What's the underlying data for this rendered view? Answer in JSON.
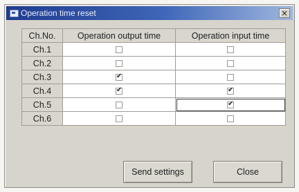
{
  "window": {
    "title": "Operation time reset",
    "close_glyph": "×"
  },
  "table": {
    "headers": [
      "Ch.No.",
      "Operation output time",
      "Operation input time"
    ],
    "rows": [
      {
        "ch": "Ch.1",
        "output_checked": false,
        "input_checked": false
      },
      {
        "ch": "Ch.2",
        "output_checked": false,
        "input_checked": false
      },
      {
        "ch": "Ch.3",
        "output_checked": true,
        "input_checked": false
      },
      {
        "ch": "Ch.4",
        "output_checked": true,
        "input_checked": true
      },
      {
        "ch": "Ch.5",
        "output_checked": false,
        "input_checked": true
      },
      {
        "ch": "Ch.6",
        "output_checked": false,
        "input_checked": false
      }
    ]
  },
  "buttons": {
    "send_label": "Send settings",
    "close_label": "Close"
  }
}
